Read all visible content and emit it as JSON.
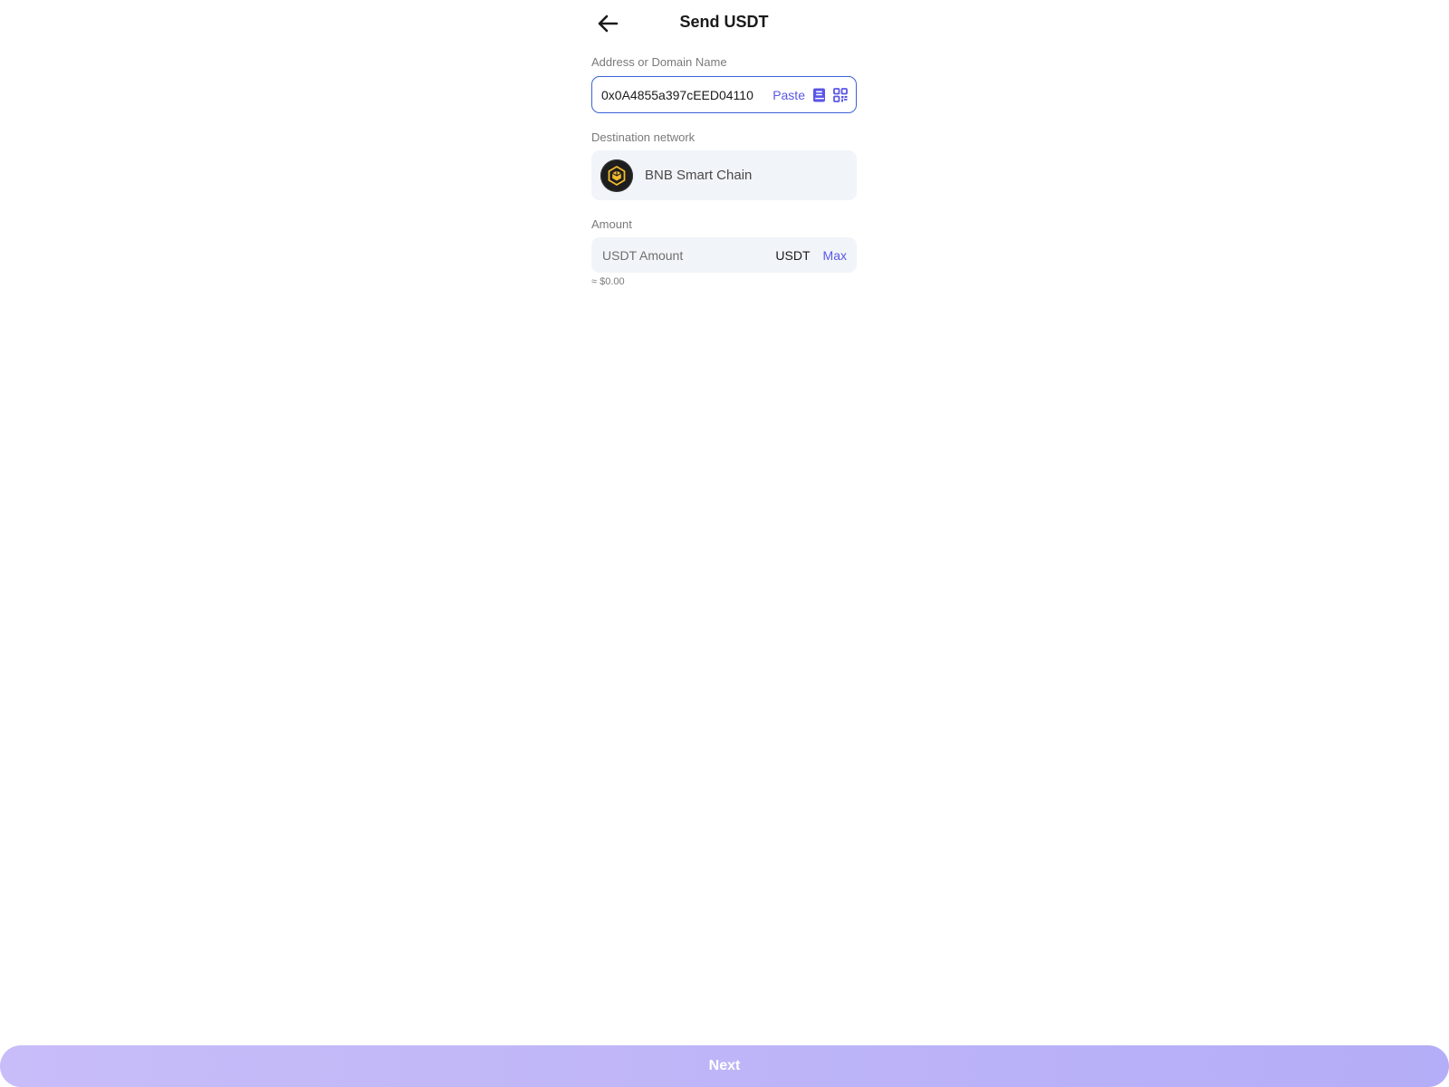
{
  "header": {
    "title": "Send USDT",
    "back_icon": "arrow-left-icon"
  },
  "address": {
    "label": "Address or Domain Name",
    "value": "0x0A4855a397cEED04110",
    "paste_label": "Paste",
    "address_book_icon": "address-book-icon",
    "qr_icon": "qr-code-icon"
  },
  "network": {
    "label": "Destination network",
    "name": "BNB Smart Chain",
    "logo_icon": "bnb-logo-icon"
  },
  "amount": {
    "label": "Amount",
    "placeholder": "USDT Amount",
    "currency": "USDT",
    "max_label": "Max",
    "usd_estimate": "≈ $0.00"
  },
  "footer": {
    "next_label": "Next"
  },
  "colors": {
    "accent": "#5b57e6",
    "input_border": "#3b63d8",
    "field_bg": "#f1f4f9",
    "next_button_start": "#c8bdf9",
    "next_button_end": "#b4adf7",
    "bnb_yellow": "#f3ba2f"
  }
}
